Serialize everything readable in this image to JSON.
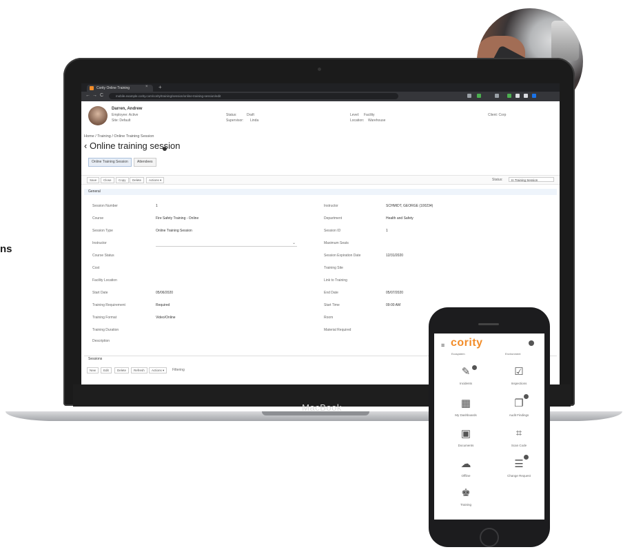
{
  "side_text": "ns",
  "browser": {
    "tab_title": "Cority Online Training",
    "tab_close": "×",
    "tab_new": "+",
    "url": "mobile.example.cority.com/cority/training/session/online-training-session/edit",
    "nav": {
      "back": "←",
      "forward": "→",
      "reload": "C"
    }
  },
  "header": {
    "name": "Darren, Andrew",
    "line1": "Employee: Active",
    "line2": "Site: Default",
    "mid1_label": "Status:",
    "mid1_value": "Draft",
    "mid2_label": "Supervisor:",
    "mid2_value": "Linda",
    "right1_label": "Level:",
    "right1_value": "Facility",
    "right2_label": "Location:",
    "right2_value": "Warehouse",
    "far_right": "Client: Corp"
  },
  "breadcrumb": "Home / Training / Online Training Session",
  "page_title": "Online training session",
  "tabs": [
    "Online Training Session",
    "Attendees"
  ],
  "toolbar": {
    "buttons": [
      "Save",
      "Close",
      "Copy",
      "Delete",
      "Actions ▾"
    ],
    "status_label": "Status:",
    "status_value": "In Training Session"
  },
  "section_general": "General",
  "fields_left": [
    {
      "label": "Session Number",
      "value": "1"
    },
    {
      "label": "Course",
      "value": "Fire Safety Training - Online"
    },
    {
      "label": "Session Type",
      "value": "Online Training Session"
    },
    {
      "label": "Instructor",
      "value": ""
    },
    {
      "label": "Course Status",
      "value": ""
    },
    {
      "label": "Cost",
      "value": ""
    },
    {
      "label": "Facility Location",
      "value": ""
    },
    {
      "label": "Start Date",
      "value": "05/06/2020"
    },
    {
      "label": "Training Requirement",
      "value": "Required"
    },
    {
      "label": "Training Format",
      "value": "Video/Online"
    },
    {
      "label": "Training Duration",
      "value": ""
    },
    {
      "label": "Description",
      "value": ""
    }
  ],
  "fields_right": [
    {
      "label": "Instructor",
      "value": "SCHMIDT, GEORGE (100234)"
    },
    {
      "label": "Department",
      "value": "Health and Safety"
    },
    {
      "label": "Session ID",
      "value": "1"
    },
    {
      "label": "Maximum Seats",
      "value": ""
    },
    {
      "label": "Session Expiration Date",
      "value": "12/31/2020"
    },
    {
      "label": "Training Site",
      "value": ""
    },
    {
      "label": "Link to Training",
      "value": ""
    },
    {
      "label": "End Date",
      "value": "05/07/2020"
    },
    {
      "label": "Start Time",
      "value": "09:00 AM"
    },
    {
      "label": "Room",
      "value": ""
    },
    {
      "label": "Material Required",
      "value": ""
    }
  ],
  "section_second": "Sessions",
  "second_toolbar": [
    "New",
    "Edit",
    "Delete",
    "Refresh",
    "Actions ▾"
  ],
  "second_toolbar_extra": "Filtering",
  "laptop_label": "MacBook",
  "mobile": {
    "logo": "cority",
    "top_labels": [
      "Ecosystem",
      "Environment"
    ],
    "tiles": [
      {
        "label": "Incidents",
        "icon": "✎"
      },
      {
        "label": "Inspections",
        "icon": "☑"
      },
      {
        "label": "My Dashboards",
        "icon": "▦"
      },
      {
        "label": "Audit Findings",
        "icon": "❐"
      },
      {
        "label": "Documents",
        "icon": "▣"
      },
      {
        "label": "Scan Code",
        "icon": "⌗"
      },
      {
        "label": "Offline",
        "icon": "☁"
      },
      {
        "label": "Change Request",
        "icon": "☰"
      },
      {
        "label": "Training",
        "icon": "♚"
      }
    ]
  }
}
